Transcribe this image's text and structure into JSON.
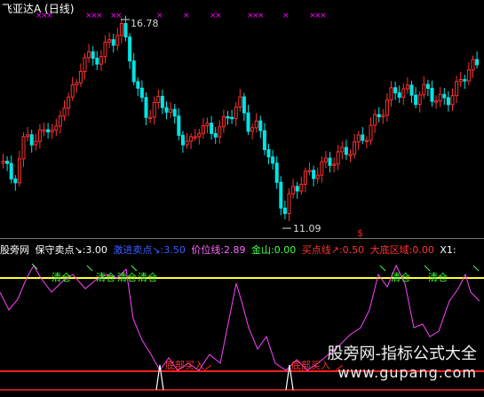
{
  "window": {
    "title": "飞亚达A (日线)"
  },
  "main_chart": {
    "high_label": "16.78",
    "low_label": "11.09",
    "sell_marker": "$",
    "colors": {
      "up": "#ff3030",
      "down": "#00e5e5",
      "marks": "#ff00ff"
    }
  },
  "indicator": {
    "name": "股旁网",
    "items": [
      {
        "text": "保守卖点↘:3.00",
        "color": "#ffffff"
      },
      {
        "text": "激进卖点↘:3.50",
        "color": "#3a5cff"
      },
      {
        "text": "价位线:2.89",
        "color": "#ff66ff"
      },
      {
        "text": "金山:0.00",
        "color": "#44ff44"
      },
      {
        "text": "买点线↗:0.50",
        "color": "#ff3333"
      },
      {
        "text": "大底区域:0.00",
        "color": "#ff3333"
      },
      {
        "text": "X1:",
        "color": "#ffffff"
      }
    ],
    "qingcang": "清仓",
    "dibu_mairu": "底部买入",
    "colors": {
      "sell_line": "#ffff33",
      "buy_line": "#ff2020",
      "price_line": "#ff44ff"
    }
  },
  "watermark": {
    "line1": "股旁网-指标公式大全",
    "line2": "www.gupang.com"
  }
}
